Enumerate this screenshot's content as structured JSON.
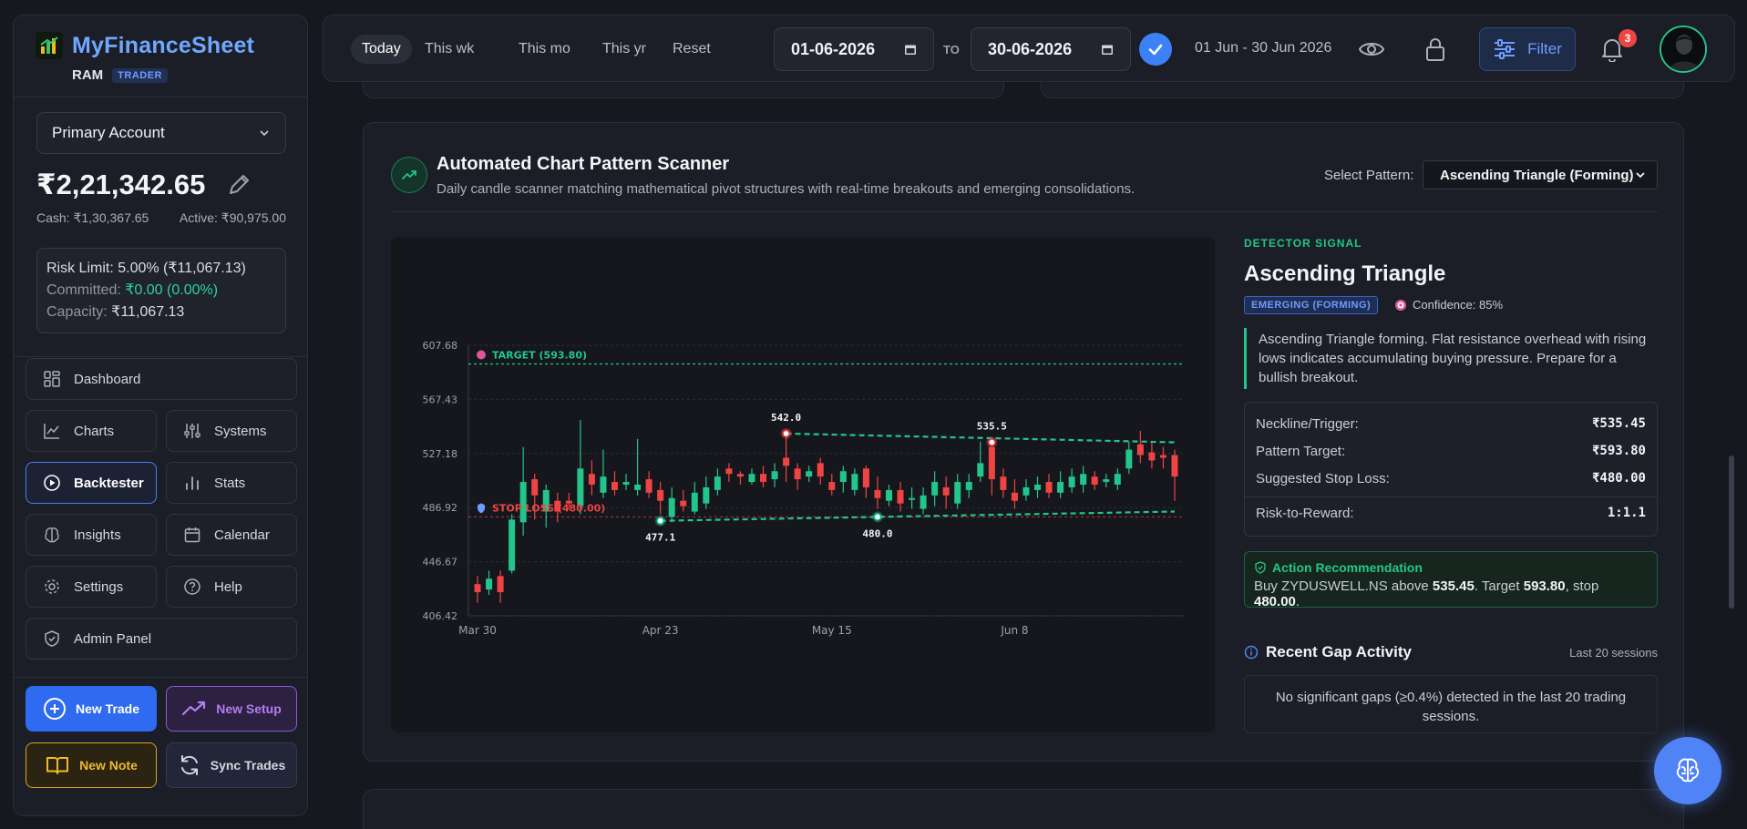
{
  "brand": {
    "title": "MyFinanceSheet",
    "user": "RAM",
    "role": "TRADER"
  },
  "account": {
    "selected": "Primary Account",
    "balance": "₹2,21,342.65",
    "cash": "Cash: ₹1,30,367.65",
    "active": "Active: ₹90,975.00",
    "risk_limit": "Risk Limit: 5.00% (₹11,067.13)",
    "committed_label": "Committed:",
    "committed_value": "₹0.00 (0.00%)",
    "capacity_label": "Capacity:",
    "capacity_value": "₹11,067.13"
  },
  "nav": {
    "dashboard": "Dashboard",
    "charts": "Charts",
    "systems": "Systems",
    "backtester": "Backtester",
    "stats": "Stats",
    "insights": "Insights",
    "calendar": "Calendar",
    "settings": "Settings",
    "help": "Help",
    "admin": "Admin Panel"
  },
  "actions": {
    "new_trade": "New Trade",
    "new_setup": "New Setup",
    "new_note": "New Note",
    "sync_trades": "Sync Trades"
  },
  "topbar": {
    "ranges": [
      "Today",
      "This wk",
      "This mo",
      "This yr",
      "Reset"
    ],
    "active_range": "Today",
    "date_from": "01-06-2026",
    "to_label": "TO",
    "date_to": "30-06-2026",
    "range_text": "01 Jun - 30 Jun 2026",
    "filter_label": "Filter",
    "notification_count": "3"
  },
  "scanner": {
    "title": "Automated Chart Pattern Scanner",
    "description": "Daily candle scanner matching mathematical pivot structures with real-time breakouts and emerging consolidations.",
    "select_label": "Select Pattern:",
    "selected_pattern": "Ascending Triangle (Forming)"
  },
  "signal": {
    "tag": "DETECTOR SIGNAL",
    "name": "Ascending Triangle",
    "status": "EMERGING (FORMING)",
    "confidence": "Confidence: 85%",
    "description": "Ascending Triangle forming. Flat resistance overhead with rising lows indicates accumulating buying pressure. Prepare for a bullish breakout.",
    "stats": [
      {
        "label": "Neckline/Trigger:",
        "value": "₹535.45",
        "color": "#f3f4f7"
      },
      {
        "label": "Pattern Target:",
        "value": "₹593.80",
        "color": "#2bd39a"
      },
      {
        "label": "Suggested Stop Loss:",
        "value": "₹480.00",
        "color": "#ff5a5f"
      },
      {
        "label": "Risk-to-Reward:",
        "value": "1:1.1",
        "color": "#f3f4f7"
      }
    ],
    "recommendation_title": "Action Recommendation",
    "recommendation": {
      "prefix": "Buy ZYDUSWELL.NS above ",
      "trigger": "535.45",
      "mid1": ". Target ",
      "target": "593.80",
      "mid2": ", stop ",
      "stop": "480.00",
      "suffix": "."
    }
  },
  "gaps": {
    "title": "Recent Gap Activity",
    "meta": "Last 20 sessions",
    "message": "No significant gaps (≥0.4%) detected in the last 20 trading sessions."
  },
  "colors": {
    "bull": "#22c58b",
    "bear": "#ef4444",
    "accent": "#3b82f6",
    "target": "#22c58b",
    "stop": "#ef4444"
  },
  "chart_data": {
    "type": "candlestick",
    "y_ticks": [
      "607.68",
      "567.43",
      "527.18",
      "486.92",
      "446.67",
      "406.42"
    ],
    "ylim": [
      406.42,
      607.68
    ],
    "x_ticks": [
      {
        "label": "Mar 30",
        "index": 0
      },
      {
        "label": "Apr 23",
        "index": 16
      },
      {
        "label": "May 15",
        "index": 31
      },
      {
        "label": "Jun 8",
        "index": 47
      }
    ],
    "target": {
      "label": "TARGET (593.80)",
      "value": 593.8
    },
    "stop": {
      "label": "STOP LOSS (480.00)",
      "value": 480.0
    },
    "resistance": {
      "from_index": 27,
      "from": 542.0,
      "to_index": 61,
      "to": 535.5
    },
    "support": {
      "from_index": 16,
      "from": 477.1,
      "to_index": 61,
      "to": 484.0
    },
    "pivots": [
      {
        "label": "542.0",
        "index": 27,
        "value": 542.0,
        "kind": "high"
      },
      {
        "label": "535.5",
        "index": 45,
        "value": 535.5,
        "kind": "high"
      },
      {
        "label": "477.1",
        "index": 16,
        "value": 477.1,
        "kind": "low"
      },
      {
        "label": "480.0",
        "index": 35,
        "value": 480.0,
        "kind": "low"
      }
    ],
    "candles": [
      [
        430,
        424,
        436,
        416
      ],
      [
        426,
        434,
        440,
        422
      ],
      [
        436,
        424,
        440,
        416
      ],
      [
        440,
        478,
        482,
        438
      ],
      [
        476,
        506,
        532,
        466
      ],
      [
        508,
        496,
        512,
        478
      ],
      [
        484,
        500,
        504,
        472
      ],
      [
        492,
        484,
        498,
        476
      ],
      [
        492,
        490,
        498,
        486
      ],
      [
        488,
        516,
        552,
        482
      ],
      [
        512,
        504,
        522,
        496
      ],
      [
        498,
        510,
        530,
        494
      ],
      [
        506,
        500,
        514,
        496
      ],
      [
        504,
        506,
        512,
        500
      ],
      [
        500,
        504,
        538,
        496
      ],
      [
        508,
        498,
        514,
        494
      ],
      [
        500,
        492,
        506,
        482
      ],
      [
        480,
        494,
        502,
        476
      ],
      [
        492,
        488,
        500,
        484
      ],
      [
        484,
        498,
        506,
        482
      ],
      [
        490,
        502,
        510,
        486
      ],
      [
        500,
        510,
        516,
        496
      ],
      [
        516,
        512,
        520,
        506
      ],
      [
        512,
        510,
        514,
        504
      ],
      [
        506,
        512,
        516,
        504
      ],
      [
        512,
        506,
        518,
        502
      ],
      [
        508,
        514,
        520,
        502
      ],
      [
        524,
        518,
        542,
        506
      ],
      [
        516,
        508,
        520,
        500
      ],
      [
        510,
        514,
        518,
        506
      ],
      [
        520,
        510,
        524,
        504
      ],
      [
        506,
        500,
        512,
        496
      ],
      [
        506,
        514,
        518,
        498
      ],
      [
        500,
        512,
        516,
        496
      ],
      [
        516,
        502,
        518,
        494
      ],
      [
        500,
        494,
        510,
        486
      ],
      [
        492,
        500,
        504,
        488
      ],
      [
        500,
        490,
        506,
        484
      ],
      [
        494,
        494,
        502,
        486
      ],
      [
        486,
        496,
        502,
        482
      ],
      [
        496,
        506,
        514,
        488
      ],
      [
        502,
        496,
        510,
        486
      ],
      [
        490,
        506,
        512,
        486
      ],
      [
        500,
        506,
        512,
        494
      ],
      [
        510,
        520,
        536,
        506
      ],
      [
        532,
        508,
        536,
        496
      ],
      [
        510,
        500,
        516,
        494
      ],
      [
        498,
        492,
        508,
        486
      ],
      [
        496,
        502,
        508,
        492
      ],
      [
        500,
        504,
        510,
        494
      ],
      [
        506,
        498,
        512,
        494
      ],
      [
        498,
        506,
        514,
        494
      ],
      [
        502,
        510,
        516,
        498
      ],
      [
        504,
        512,
        518,
        498
      ],
      [
        510,
        504,
        514,
        500
      ],
      [
        506,
        508,
        512,
        502
      ],
      [
        504,
        512,
        516,
        500
      ],
      [
        516,
        530,
        536,
        512
      ],
      [
        534,
        526,
        544,
        520
      ],
      [
        528,
        522,
        536,
        516
      ],
      [
        526,
        524,
        532,
        516
      ],
      [
        526,
        510,
        530,
        492
      ]
    ]
  }
}
